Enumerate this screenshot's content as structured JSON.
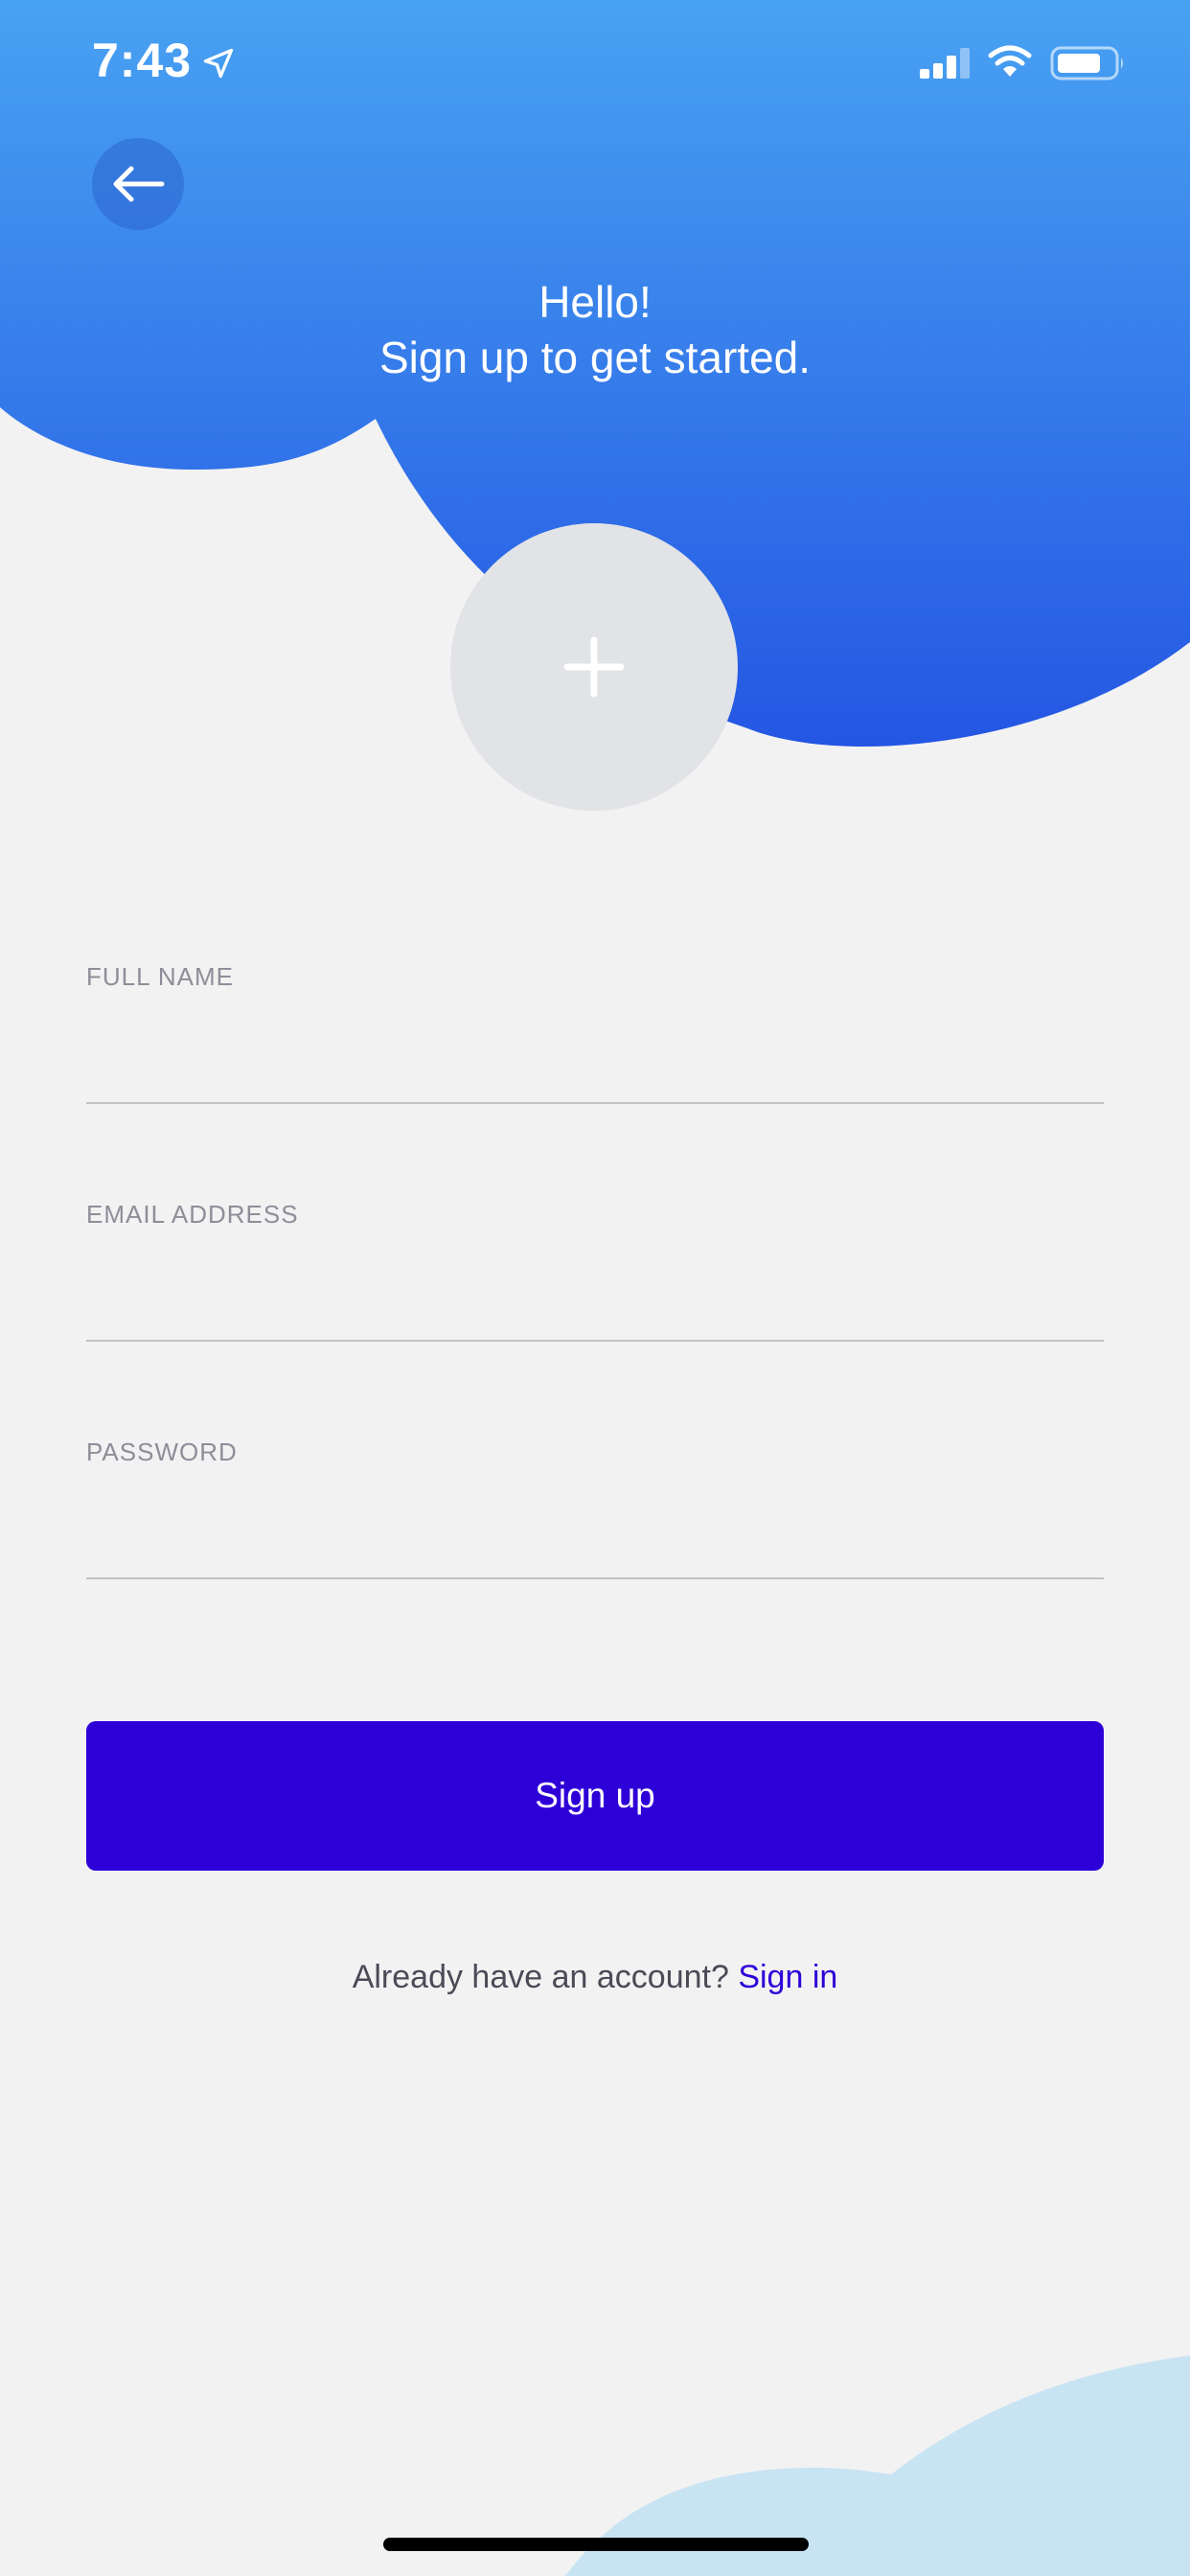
{
  "status_bar": {
    "time": "7:43",
    "icons": [
      "location-arrow-icon",
      "cellular-signal-icon",
      "wifi-icon",
      "battery-icon"
    ]
  },
  "header": {
    "back_icon": "arrow-left-icon",
    "title_line1": "Hello!",
    "title_line2": "Sign up to get started."
  },
  "avatar": {
    "icon": "plus-icon"
  },
  "form": {
    "full_name": {
      "label": "FULL NAME",
      "value": ""
    },
    "email": {
      "label": "EMAIL ADDRESS",
      "value": ""
    },
    "password": {
      "label": "PASSWORD",
      "value": ""
    }
  },
  "actions": {
    "signup_label": "Sign up",
    "signin_prompt": "Already have an account?",
    "signin_link": "Sign in"
  },
  "colors": {
    "header_gradient_top": "#48a2f2",
    "header_gradient_bottom": "#2456e3",
    "primary": "#2e00d8",
    "background": "#f2f2f3",
    "bottom_cloud": "#c8e4f2"
  }
}
